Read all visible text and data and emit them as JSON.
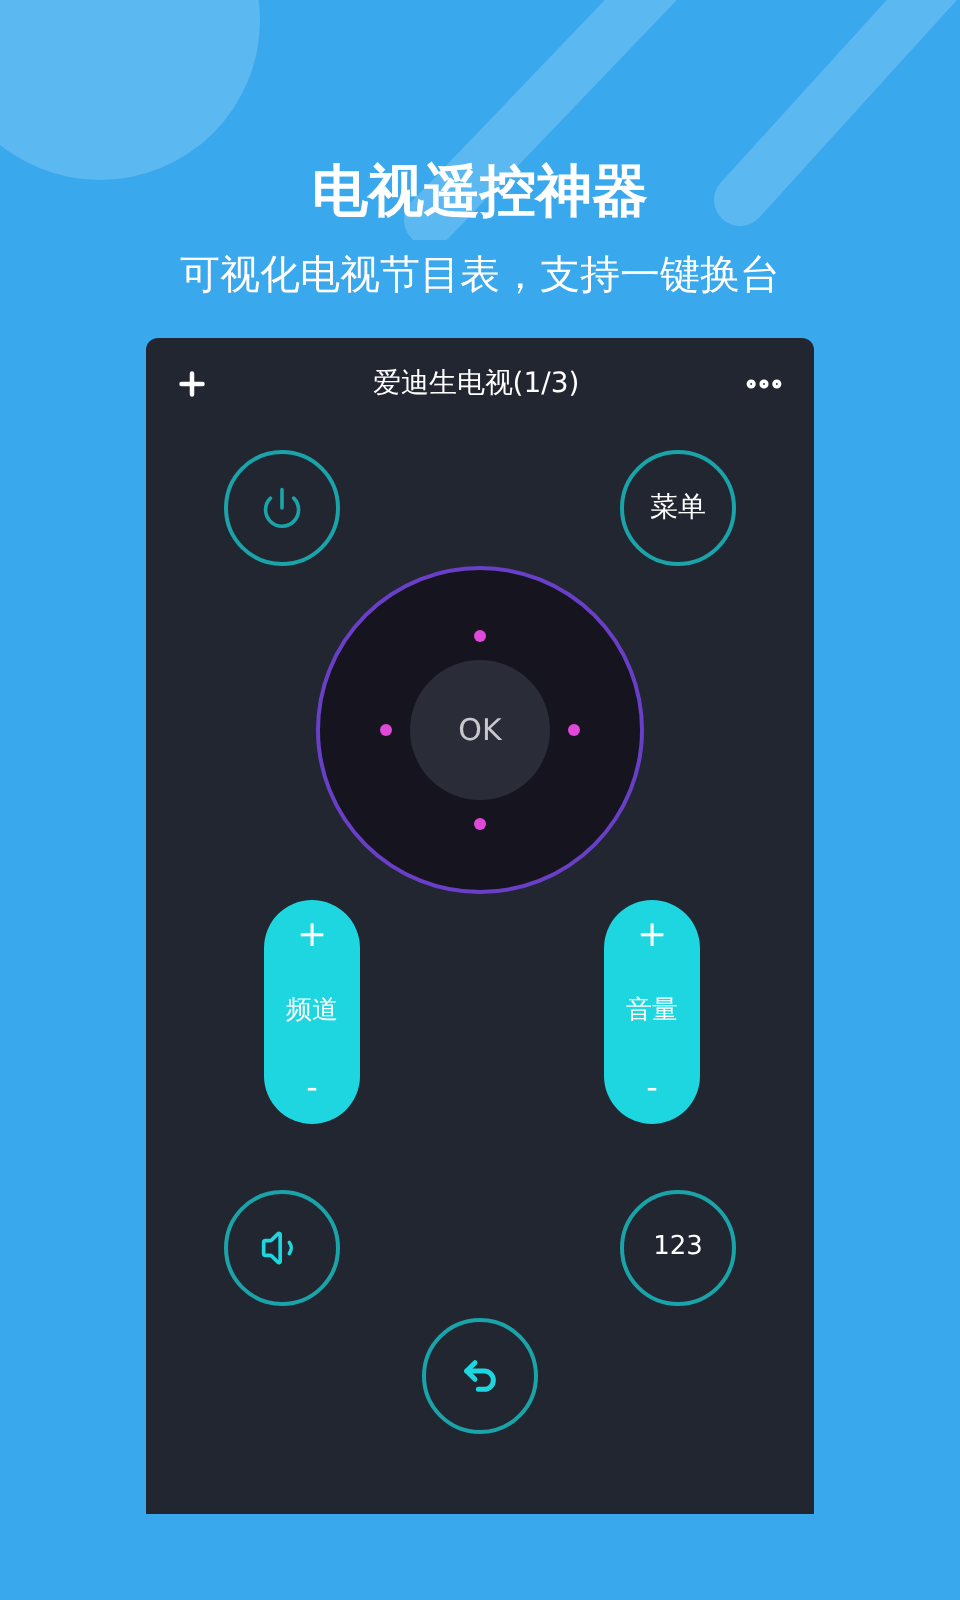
{
  "header": {
    "title": "电视遥控神器",
    "subtitle": "可视化电视节目表，支持一键换台"
  },
  "remote": {
    "title": "爱迪生电视(1/3)",
    "menu_button": "菜单",
    "ok_button": "OK",
    "rockers": [
      {
        "label": "频道",
        "plus": "+",
        "minus": "-"
      },
      {
        "label": "音量",
        "plus": "+",
        "minus": "-"
      }
    ],
    "number_button": "123"
  }
}
